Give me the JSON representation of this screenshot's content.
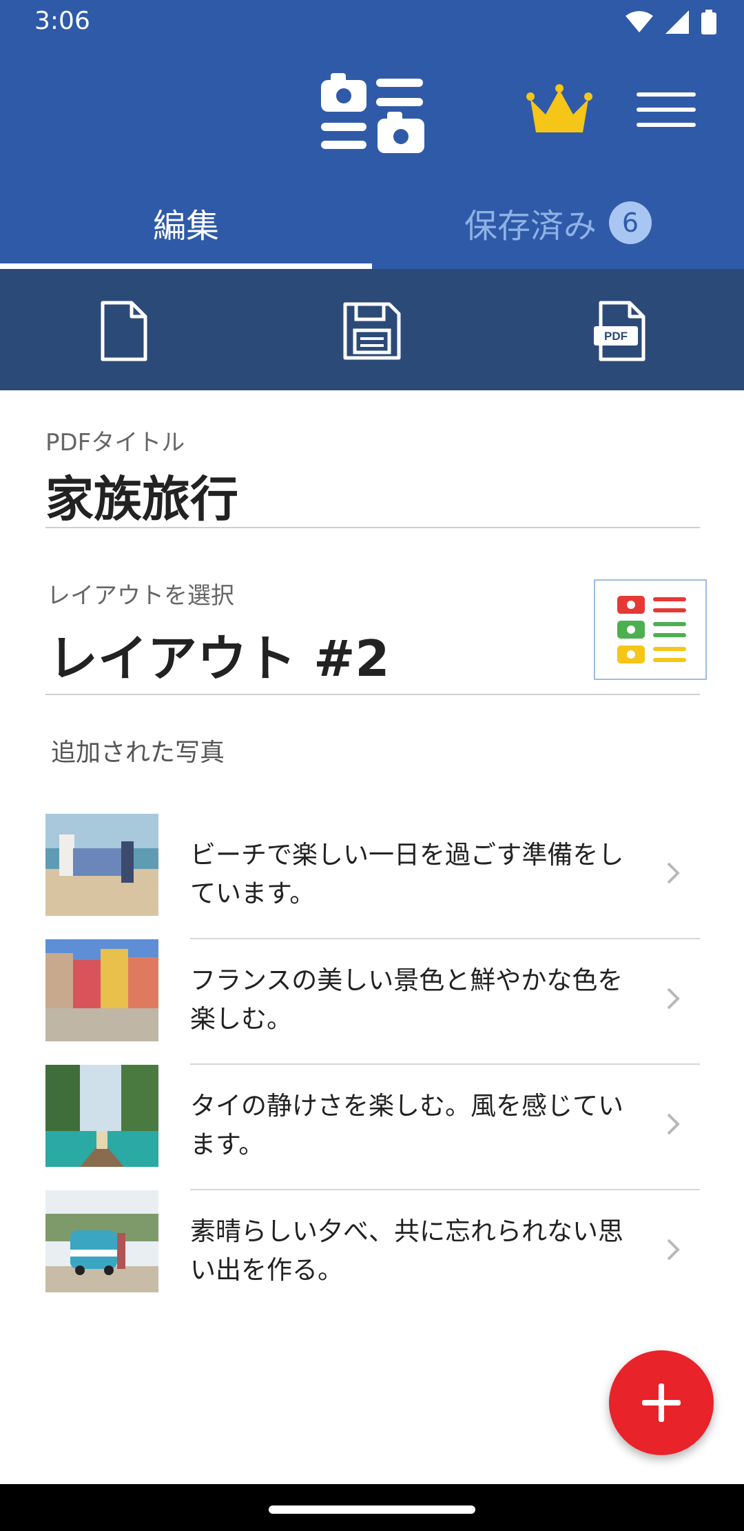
{
  "status_bar": {
    "time": "3:06"
  },
  "app_bar": {
    "logo_icon": "photo-list-icon",
    "premium_icon": "crown-icon",
    "menu_icon": "hamburger-menu-icon"
  },
  "tabs": [
    {
      "label": "編集",
      "active": true
    },
    {
      "label": "保存済み",
      "badge": "6",
      "active": false
    }
  ],
  "toolbar": {
    "items": [
      "new-document-icon",
      "save-icon",
      "pdf-icon"
    ],
    "pdf_text": "PDF"
  },
  "form": {
    "pdf_title_label": "PDFタイトル",
    "pdf_title_value": "家族旅行",
    "layout_label": "レイアウトを選択",
    "layout_value": "レイアウト #2"
  },
  "photos_section": {
    "title": "追加された写真",
    "items": [
      {
        "caption": "ビーチで楽しい一日を過ごす準備をしています。"
      },
      {
        "caption": "フランスの美しい景色と鮮やかな色を楽しむ。"
      },
      {
        "caption": "タイの静けさを楽しむ。風を感じています。"
      },
      {
        "caption": "素晴らしい夕べ、共に忘れられない思い出を作る。"
      }
    ]
  },
  "colors": {
    "primary": "#2f5aa8",
    "toolbar": "#2c4a78",
    "accent": "#e8232a",
    "crown": "#f5c518"
  }
}
